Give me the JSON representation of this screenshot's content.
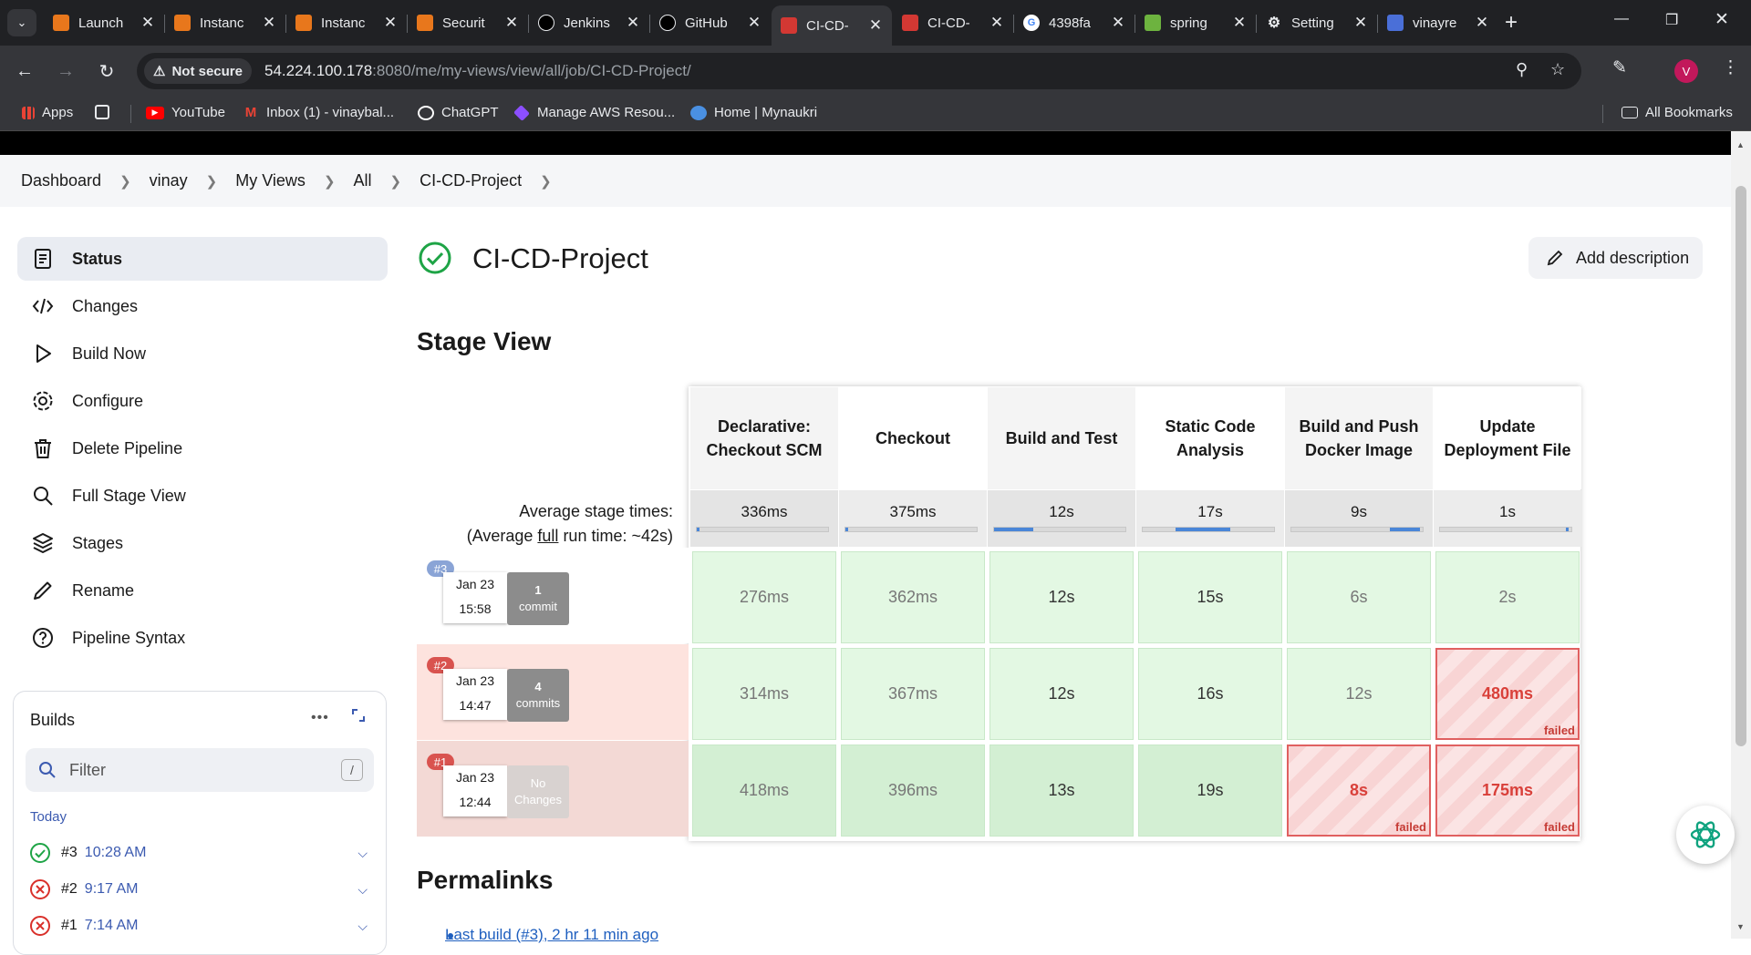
{
  "browser": {
    "tabs": [
      {
        "title": "Launch",
        "icon": "aws-icon",
        "color": "#e8771c"
      },
      {
        "title": "Instanc",
        "icon": "aws-icon",
        "color": "#e8771c"
      },
      {
        "title": "Instanc",
        "icon": "aws-icon",
        "color": "#e8771c"
      },
      {
        "title": "Securit",
        "icon": "aws-icon",
        "color": "#e8771c"
      },
      {
        "title": "Jenkins",
        "icon": "github-icon",
        "color": "#000000"
      },
      {
        "title": "GitHub",
        "icon": "github-icon",
        "color": "#000000"
      },
      {
        "title": "CI-CD-",
        "icon": "jenkins-icon",
        "color": "#d33833",
        "active": true
      },
      {
        "title": "CI-CD-",
        "icon": "jenkins-icon",
        "color": "#d33833"
      },
      {
        "title": "4398fa",
        "icon": "google-icon",
        "color": "#4285f4"
      },
      {
        "title": "spring",
        "icon": "spring-icon",
        "color": "#6db33f"
      },
      {
        "title": "Setting",
        "icon": "settings-icon",
        "color": "#9aa0a6"
      },
      {
        "title": "vinayre",
        "icon": "site-icon",
        "color": "#4a6fd8"
      }
    ],
    "security_label": "Not secure",
    "url_host": "54.224.100.178",
    "url_rest": ":8080/me/my-views/view/all/job/CI-CD-Project/",
    "profile_initial": "V",
    "bookmarks": [
      {
        "label": "Apps",
        "icon": "apps-grid-icon"
      },
      {
        "label": "",
        "icon": "tab-groups-icon"
      },
      {
        "label": "YouTube",
        "icon": "youtube-icon",
        "color": "#ff0000"
      },
      {
        "label": "Inbox (1) - vinaybal...",
        "icon": "gmail-icon",
        "color": "#ea4335"
      },
      {
        "label": "ChatGPT",
        "icon": "chatgpt-icon",
        "color": "#ffffff"
      },
      {
        "label": "Manage AWS Resou...",
        "icon": "aws-cube-icon",
        "color": "#8c4fff"
      },
      {
        "label": "Home | Mynaukri",
        "icon": "naukri-icon",
        "color": "#4a90e2"
      }
    ],
    "all_bookmarks": "All Bookmarks"
  },
  "breadcrumb": [
    "Dashboard",
    "vinay",
    "My Views",
    "All",
    "CI-CD-Project"
  ],
  "sidebar": {
    "items": [
      {
        "label": "Status",
        "icon": "status-icon",
        "active": true
      },
      {
        "label": "Changes",
        "icon": "code-icon"
      },
      {
        "label": "Build Now",
        "icon": "play-icon"
      },
      {
        "label": "Configure",
        "icon": "gear-icon"
      },
      {
        "label": "Delete Pipeline",
        "icon": "trash-icon"
      },
      {
        "label": "Full Stage View",
        "icon": "search-icon"
      },
      {
        "label": "Stages",
        "icon": "layers-icon"
      },
      {
        "label": "Rename",
        "icon": "pencil-icon"
      },
      {
        "label": "Pipeline Syntax",
        "icon": "help-icon"
      }
    ]
  },
  "builds": {
    "title": "Builds",
    "filter_placeholder": "Filter",
    "filter_shortcut": "/",
    "group": "Today",
    "items": [
      {
        "number": "#3",
        "time": "10:28 AM",
        "status": "success"
      },
      {
        "number": "#2",
        "time": "9:17 AM",
        "status": "failed"
      },
      {
        "number": "#1",
        "time": "7:14 AM",
        "status": "failed"
      }
    ]
  },
  "main": {
    "title": "CI-CD-Project",
    "add_description": "Add description",
    "stage_view_title": "Stage View",
    "avg_label_1": "Average stage times:",
    "avg_label_2_pre": "(Average ",
    "avg_label_2_link": "full",
    "avg_label_2_post": " run time: ~42s)",
    "permalinks_title": "Permalinks",
    "permalink_first": "Last build (#3), 2 hr 11 min ago"
  },
  "stage_view": {
    "stages": [
      {
        "name": "Declarative: Checkout SCM",
        "avg": "336ms",
        "bar_start": 0,
        "bar_width": 0.02
      },
      {
        "name": "Checkout",
        "avg": "375ms",
        "bar_start": 0,
        "bar_width": 0.02
      },
      {
        "name": "Build and Test",
        "avg": "12s",
        "bar_start": 0,
        "bar_width": 0.3
      },
      {
        "name": "Static Code Analysis",
        "avg": "17s",
        "bar_start": 0.25,
        "bar_width": 0.42
      },
      {
        "name": "Build and Push Docker Image",
        "avg": "9s",
        "bar_start": 0.75,
        "bar_width": 0.23
      },
      {
        "name": "Update Deployment File",
        "avg": "1s",
        "bar_start": 0.96,
        "bar_width": 0.02
      }
    ],
    "runs": [
      {
        "badge": "#3",
        "badge_color": "#8aa4d6",
        "date": "Jan 23",
        "time": "15:58",
        "changes_1": "1",
        "changes_2": "commit",
        "changes_bg": "#8c8c8c",
        "cells": [
          {
            "v": "276ms"
          },
          {
            "v": "362ms"
          },
          {
            "v": "12s"
          },
          {
            "v": "15s"
          },
          {
            "v": "6s"
          },
          {
            "v": "2s"
          }
        ],
        "band": "#ffffff"
      },
      {
        "badge": "#2",
        "badge_color": "#d9534f",
        "date": "Jan 23",
        "time": "14:47",
        "changes_1": "4",
        "changes_2": "commits",
        "changes_bg": "#8c8c8c",
        "cells": [
          {
            "v": "314ms"
          },
          {
            "v": "367ms"
          },
          {
            "v": "12s"
          },
          {
            "v": "16s"
          },
          {
            "v": "12s"
          },
          {
            "v": "480ms",
            "failed": true
          }
        ],
        "band": "#fde3de"
      },
      {
        "badge": "#1",
        "badge_color": "#d9534f",
        "date": "Jan 23",
        "time": "12:44",
        "changes_1": "No",
        "changes_2": "Changes",
        "changes_bg": "#d8d2d0",
        "cells": [
          {
            "v": "418ms"
          },
          {
            "v": "396ms"
          },
          {
            "v": "13s"
          },
          {
            "v": "19s"
          },
          {
            "v": "8s",
            "failed": true
          },
          {
            "v": "175ms",
            "failed": true
          }
        ],
        "band": "#f3d9d5"
      }
    ],
    "failed_label": "failed"
  }
}
